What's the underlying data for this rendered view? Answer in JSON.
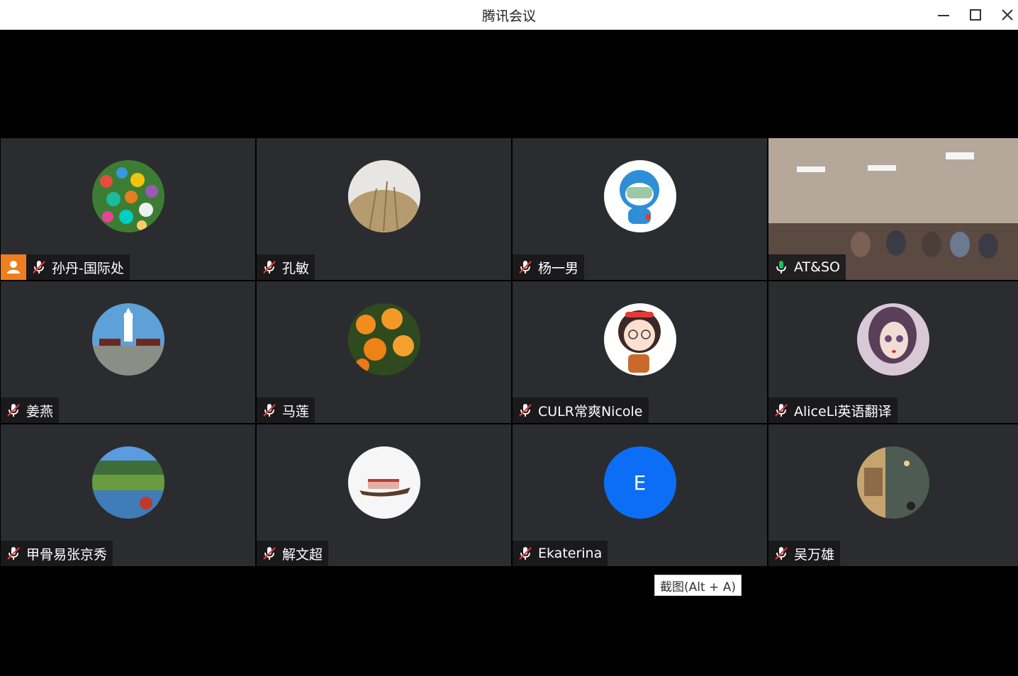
{
  "window": {
    "title": "腾讯会议"
  },
  "participants": [
    {
      "name": "孙丹-国际处",
      "mic": "muted",
      "host": true
    },
    {
      "name": "孔敏",
      "mic": "muted"
    },
    {
      "name": "杨一男",
      "mic": "muted"
    },
    {
      "name": "AT&SO",
      "mic": "on"
    },
    {
      "name": "姜燕",
      "mic": "muted"
    },
    {
      "name": "马莲",
      "mic": "muted"
    },
    {
      "name": "CULR常爽Nicole",
      "mic": "muted"
    },
    {
      "name": "AliceLi英语翻译",
      "mic": "muted"
    },
    {
      "name": "甲骨易张京秀",
      "mic": "muted"
    },
    {
      "name": "解文超",
      "mic": "muted"
    },
    {
      "name": "Ekaterina",
      "mic": "muted",
      "avatar_letter": "E"
    },
    {
      "name": "吴万雄",
      "mic": "muted"
    }
  ],
  "tooltip": {
    "text": "截图(Alt + A)"
  },
  "colors": {
    "accent_active": "#1fc25b",
    "host_badge": "#f07d1e",
    "letter_avatar": "#0b6ef5"
  }
}
